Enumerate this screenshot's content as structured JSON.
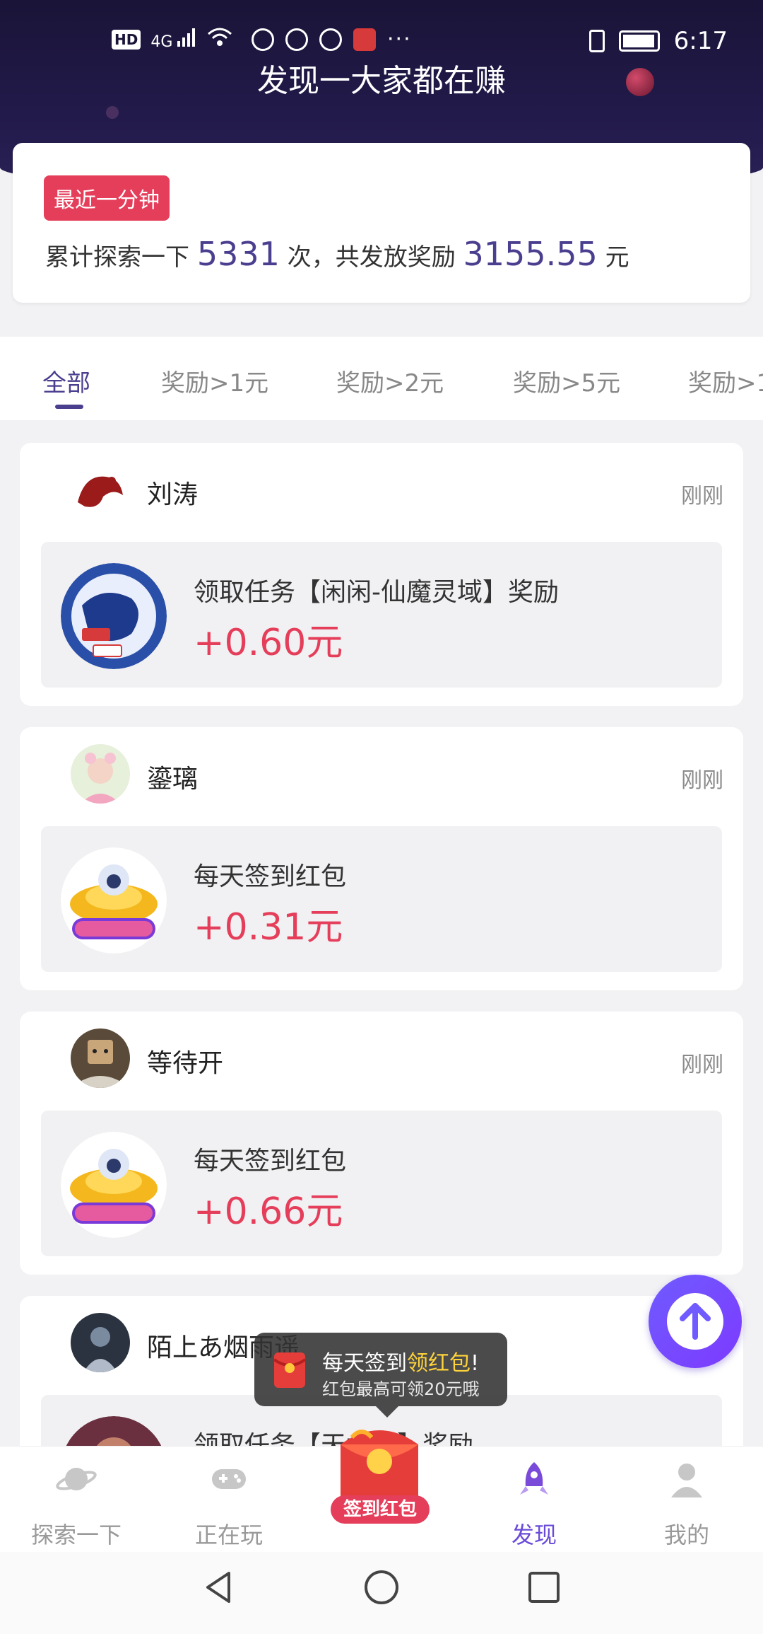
{
  "status_bar": {
    "network": "HD",
    "signal": "4G",
    "time": "6:17"
  },
  "page_title": "发现一大家都在赚",
  "stats": {
    "badge": "最近一分钟",
    "prefix": "累计探索一下",
    "explore_count": "5331",
    "middle": "次，共发放奖励",
    "reward_total": "3155.55",
    "unit": "元"
  },
  "tabs": [
    {
      "label": "全部"
    },
    {
      "label": "奖励>1元"
    },
    {
      "label": "奖励>2元"
    },
    {
      "label": "奖励>5元"
    },
    {
      "label": "奖励>1"
    }
  ],
  "feed": [
    {
      "user": "刘涛",
      "time": "刚刚",
      "task": "领取任务【闲闲-仙魔灵域】奖励",
      "reward": "+0.60元",
      "icon": "game-xianmo-icon"
    },
    {
      "user": "鎏璃",
      "time": "刚刚",
      "task": "每天签到红包",
      "reward": "+0.31元",
      "icon": "ufo-icon"
    },
    {
      "user": "等待开",
      "time": "刚刚",
      "task": "每天签到红包",
      "reward": "+0.66元",
      "icon": "ufo-icon"
    },
    {
      "user": "陌上あ烟雨遥",
      "task": "领取任务【天龙八】奖励"
    }
  ],
  "tooltip": {
    "title_prefix": "每天签到",
    "title_highlight": "领红包",
    "title_suffix": "!",
    "subtitle": "红包最高可领20元哦"
  },
  "bottom_nav": {
    "items": [
      {
        "label": "探索一下",
        "icon": "planet-icon"
      },
      {
        "label": "正在玩",
        "icon": "gamepad-icon"
      },
      {
        "label": "签到红包",
        "icon": "red-envelope-icon"
      },
      {
        "label": "发现",
        "icon": "rocket-icon"
      },
      {
        "label": "我的",
        "icon": "user-icon"
      }
    ]
  },
  "colors": {
    "accent": "#4a3f8f",
    "reward": "#e53e5a",
    "header": "#1a1438",
    "active_nav": "#6a4bd8"
  }
}
